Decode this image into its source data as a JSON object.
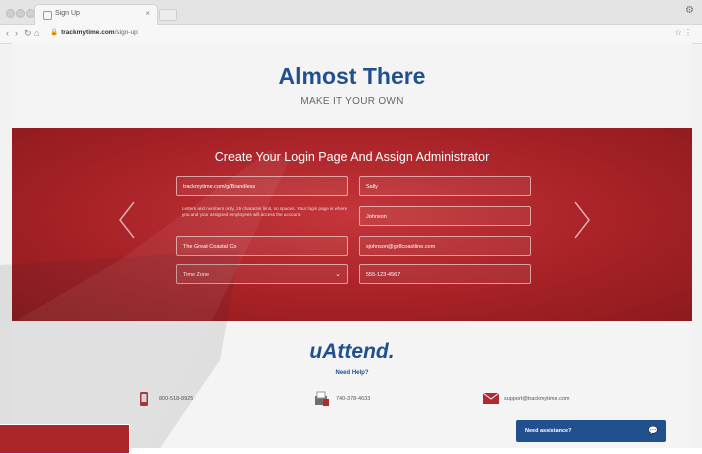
{
  "browser": {
    "tab_title": "Sign Up",
    "url_domain": "trackmytime.com",
    "url_path": "/sign-up",
    "tab_close": "×",
    "menu": "⚙",
    "nav_back": "‹",
    "nav_forward": "›",
    "nav_reload": "↻",
    "nav_home": "⌂",
    "lock_glyph": "🔒",
    "right_icons": "☆ ⋮"
  },
  "hero": {
    "title": "Almost There",
    "subtitle": "MAKE IT YOUR OWN"
  },
  "form": {
    "heading": "Create Your Login Page And Assign Administrator",
    "left": {
      "login_url_value": "trackmytime.com/g/Brandless",
      "help_text": "Letters and numbers only, 15 character limit, no spaces. Your login page is where you and your assigned employees will access the account.",
      "company_value": "The Great Coastal Co",
      "timezone_label": "Time Zone",
      "timezone_chevron": "⌄"
    },
    "right": {
      "first_name_value": "Sally",
      "last_name_value": "Johnson",
      "email_value": "sjohnson@gr8coastline.com",
      "phone_value": "555-123-4567"
    },
    "prev_arrow": "‹",
    "next_arrow": "›"
  },
  "footer": {
    "logo": "uAttend.",
    "need_help": "Need Help?",
    "contacts": [
      {
        "icon": "phone-icon",
        "text": "800-518-8925"
      },
      {
        "icon": "fax-icon",
        "text": "740-378-4633"
      },
      {
        "icon": "email-icon",
        "text": "support@trackmytime.com"
      }
    ]
  },
  "chat": {
    "label": "Need assistance?",
    "icon": "chat-icon",
    "glyph": "💬"
  },
  "colors": {
    "brand_blue": "#21508f",
    "band_red": "#a82227"
  }
}
